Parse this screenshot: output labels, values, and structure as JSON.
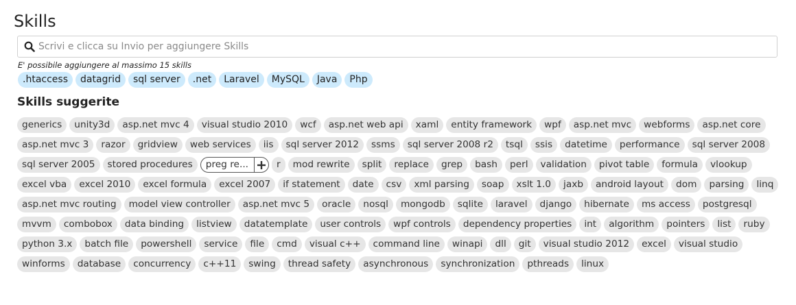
{
  "page": {
    "title": "Skills"
  },
  "search": {
    "placeholder": "Scrivi e clicca su Invio per aggiungere Skills",
    "icon": "search-icon"
  },
  "hint": "E' possibile aggiungere al massimo 15 skills",
  "selected": [
    ".htaccess",
    "datagrid",
    "sql server",
    ".net",
    "Laravel",
    "MySQL",
    "Java",
    "Php"
  ],
  "suggested_title": "Skills suggerite",
  "suggested": [
    "generics",
    "unity3d",
    "asp.net mvc 4",
    "visual studio 2010",
    "wcf",
    "asp.net web api",
    "xaml",
    "entity framework",
    "wpf",
    "asp.net mvc",
    "webforms",
    "asp.net core",
    "asp.net mvc 3",
    "razor",
    "gridview",
    "web services",
    "iis",
    "sql server 2012",
    "ssms",
    "sql server 2008 r2",
    "tsql",
    "ssis",
    "datetime",
    "performance",
    "sql server 2008",
    "sql server 2005",
    "stored procedures",
    "preg re...",
    "r",
    "mod rewrite",
    "split",
    "replace",
    "grep",
    "bash",
    "perl",
    "validation",
    "pivot table",
    "formula",
    "vlookup",
    "excel vba",
    "excel 2010",
    "excel formula",
    "excel 2007",
    "if statement",
    "date",
    "csv",
    "xml parsing",
    "soap",
    "xslt 1.0",
    "jaxb",
    "android layout",
    "dom",
    "parsing",
    "linq",
    "asp.net mvc routing",
    "model view controller",
    "asp.net mvc 5",
    "oracle",
    "nosql",
    "mongodb",
    "sqlite",
    "laravel",
    "django",
    "hibernate",
    "ms access",
    "postgresql",
    "mvvm",
    "combobox",
    "data binding",
    "listview",
    "datatemplate",
    "user controls",
    "wpf controls",
    "dependency properties",
    "int",
    "algorithm",
    "pointers",
    "list",
    "ruby",
    "python 3.x",
    "batch file",
    "powershell",
    "service",
    "file",
    "cmd",
    "visual c++",
    "command line",
    "winapi",
    "dll",
    "git",
    "visual studio 2012",
    "excel",
    "visual studio",
    "winforms",
    "database",
    "concurrency",
    "c++11",
    "swing",
    "thread safety",
    "asynchronous",
    "synchronization",
    "pthreads",
    "linux"
  ],
  "active_suggestion_index": 27,
  "colors": {
    "selected_chip": "#cdeafc",
    "suggested_chip": "#e6e6e6"
  }
}
